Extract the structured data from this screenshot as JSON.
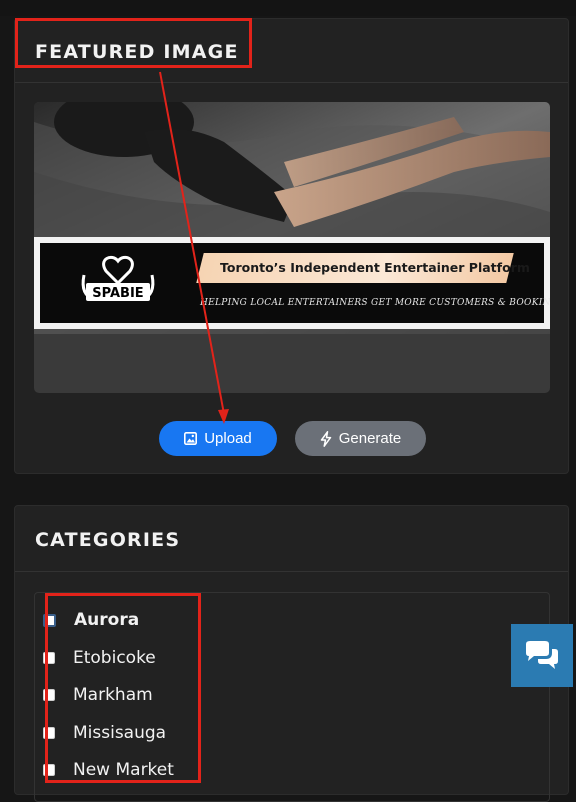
{
  "featured": {
    "title": "FEATURED IMAGE",
    "banner": {
      "brand": "SPABIE",
      "tagline": "Toronto’s Independent Entertainer Platform",
      "subline": "HELPING LOCAL ENTERTAINERS GET MORE CUSTOMERS & BOOKINGS"
    },
    "buttons": {
      "upload_label": "Upload",
      "upload_icon": "image-upload-icon",
      "generate_label": "Generate",
      "generate_icon": "lightning-bolt-icon"
    }
  },
  "categories": {
    "title": "CATEGORIES",
    "items": [
      {
        "label": "Aurora",
        "checked": false,
        "focused": true
      },
      {
        "label": "Etobicoke",
        "checked": false
      },
      {
        "label": "Markham",
        "checked": false
      },
      {
        "label": "Missisauga",
        "checked": false
      },
      {
        "label": "New Market",
        "checked": false
      }
    ]
  },
  "chat_widget": {
    "icon": "chat-bubbles-icon"
  },
  "colors": {
    "page_bg": "#161616",
    "panel_bg": "#222222",
    "primary": "#1877f2",
    "secondary": "#6b7078",
    "annotation": "#e2231a",
    "chat": "#2b7bb2"
  }
}
